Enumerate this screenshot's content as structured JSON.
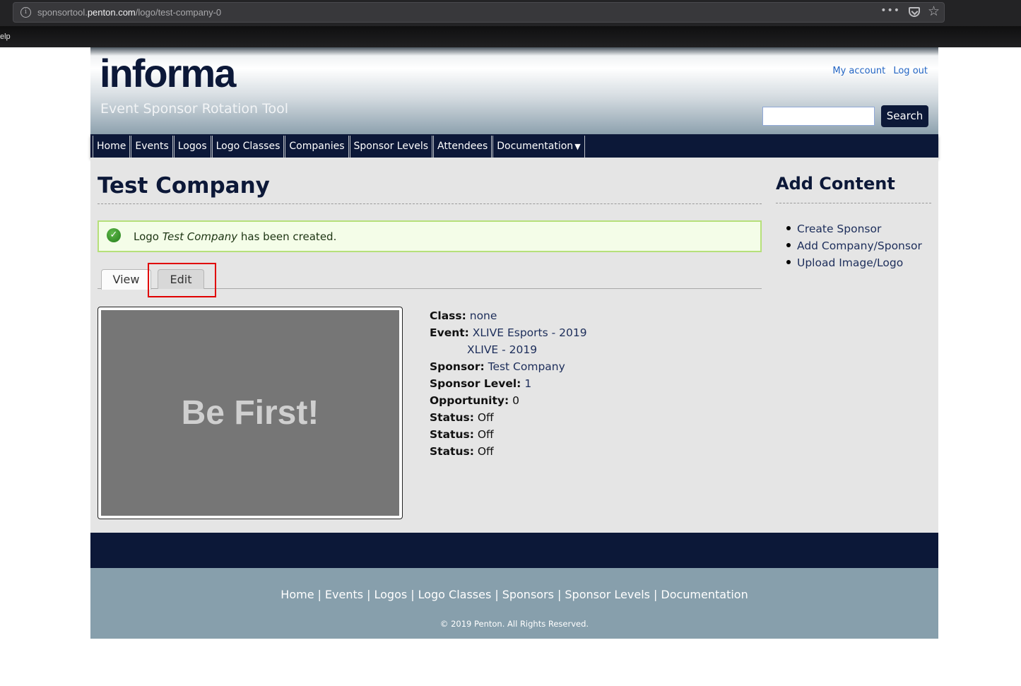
{
  "browser": {
    "url_prefix": "sponsortool.",
    "url_domain": "penton.com",
    "url_path": "/logo/test-company-0",
    "partial_menu_text": "elp"
  },
  "header": {
    "logo_text": "informa",
    "site_name": "Event Sponsor Rotation Tool",
    "user_links": [
      "My account",
      "Log out"
    ],
    "search_placeholder": "",
    "search_value": "",
    "search_button": "Search"
  },
  "nav": {
    "items": [
      "Home",
      "Events",
      "Logos",
      "Logo Classes",
      "Companies",
      "Sponsor Levels",
      "Attendees",
      "Documentation"
    ],
    "dropdown_caret": "▼"
  },
  "main": {
    "title": "Test Company",
    "message": {
      "prefix": "Logo ",
      "emphasis": "Test Company",
      "suffix": " has been created."
    },
    "tabs": [
      "View",
      "Edit"
    ],
    "active_tab": "View",
    "highlighted_tab": "Edit",
    "image_placeholder_text": "Be First!",
    "details": {
      "class_label": "Class:",
      "class_value": "none",
      "event_label": "Event:",
      "event_values": [
        "XLIVE Esports - 2019",
        "XLIVE - 2019"
      ],
      "sponsor_label": "Sponsor:",
      "sponsor_value": "Test Company",
      "sponsor_level_label": "Sponsor Level:",
      "sponsor_level_value": "1",
      "opportunity_label": "Opportunity:",
      "opportunity_value": "0",
      "statuses": [
        {
          "label": "Status:",
          "value": "Off"
        },
        {
          "label": "Status:",
          "value": "Off"
        },
        {
          "label": "Status:",
          "value": "Off"
        }
      ]
    }
  },
  "sidebar": {
    "title": "Add Content",
    "links": [
      "Create Sponsor",
      "Add Company/Sponsor",
      "Upload Image/Logo"
    ]
  },
  "footer": {
    "links": [
      "Home",
      "Events",
      "Logos",
      "Logo Classes",
      "Sponsors",
      "Sponsor Levels",
      "Documentation"
    ],
    "separator": "|",
    "copyright": "© 2019 Penton. All Rights Reserved."
  },
  "colors": {
    "brand_navy": "#0c1838",
    "link_blue": "#2365c4",
    "success_bg": "#f4fde8",
    "success_border": "#b6e07a",
    "highlight_red": "#e00000",
    "footer_gray_blue": "#879fac",
    "content_bg": "#e5e5e5"
  }
}
